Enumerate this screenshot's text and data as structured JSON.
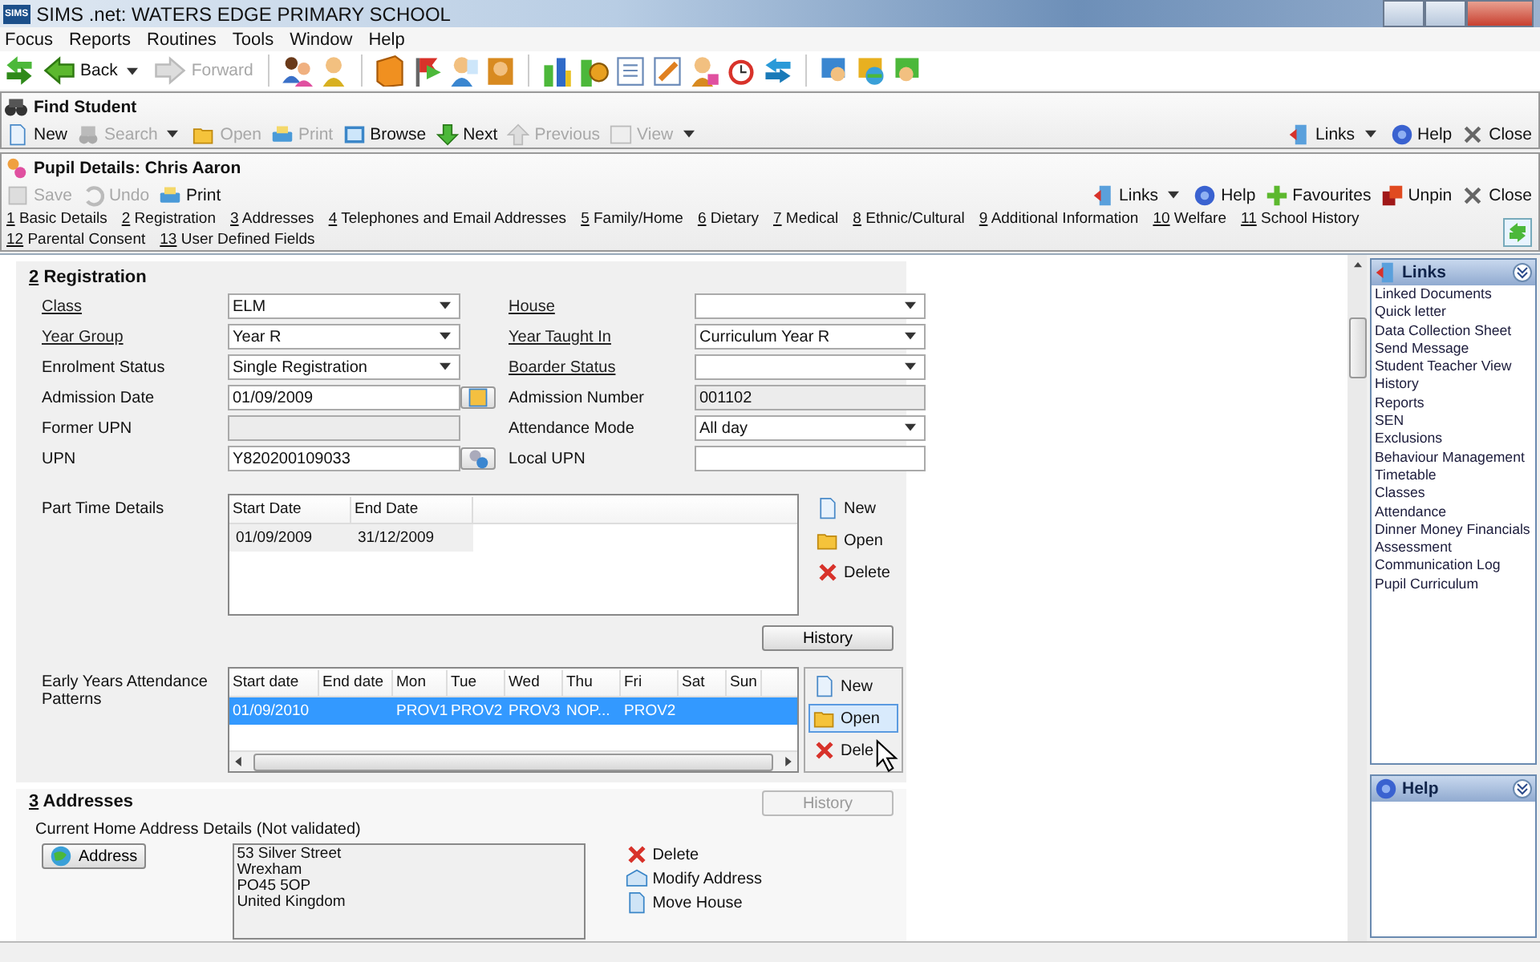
{
  "window": {
    "logo": "SIMS",
    "title": "SIMS .net: WATERS EDGE PRIMARY SCHOOL"
  },
  "menu": [
    {
      "label": "Focus"
    },
    {
      "label": "Reports"
    },
    {
      "label": "Routines"
    },
    {
      "label": "Tools"
    },
    {
      "label": "Window"
    },
    {
      "label": "Help"
    }
  ],
  "main_toolbar": [
    {
      "label": "Back",
      "kind": "back",
      "disabled": false,
      "dropdown": true
    },
    {
      "label": "Forward",
      "kind": "forward",
      "disabled": true,
      "dropdown": false
    }
  ],
  "find_student": {
    "title": "Find Student",
    "tools": [
      {
        "label": "New",
        "kind": "new",
        "disabled": false,
        "dropdown": false
      },
      {
        "label": "Search",
        "kind": "search",
        "disabled": true,
        "dropdown": true
      },
      {
        "label": "Open",
        "kind": "open",
        "disabled": true,
        "dropdown": false
      },
      {
        "label": "Print",
        "kind": "print",
        "disabled": true,
        "dropdown": false
      },
      {
        "label": "Browse",
        "kind": "browse",
        "disabled": false,
        "dropdown": false
      },
      {
        "label": "Next",
        "kind": "next",
        "disabled": false,
        "dropdown": false
      },
      {
        "label": "Previous",
        "kind": "previous",
        "disabled": true,
        "dropdown": false
      },
      {
        "label": "View",
        "kind": "view",
        "disabled": true,
        "dropdown": true
      }
    ],
    "right_tools": [
      {
        "label": "Links",
        "kind": "links",
        "dropdown": true
      },
      {
        "label": "Help",
        "kind": "help",
        "dropdown": false
      },
      {
        "label": "Close",
        "kind": "close",
        "dropdown": false
      }
    ]
  },
  "pupil": {
    "title": "Pupil Details: Chris Aaron",
    "tools": [
      {
        "label": "Save",
        "kind": "save",
        "disabled": true
      },
      {
        "label": "Undo",
        "kind": "undo",
        "disabled": true
      },
      {
        "label": "Print",
        "kind": "print",
        "disabled": false
      }
    ],
    "right_tools": [
      {
        "label": "Links",
        "kind": "links",
        "dropdown": true
      },
      {
        "label": "Help",
        "kind": "help",
        "dropdown": false
      },
      {
        "label": "Favourites",
        "kind": "favourites",
        "dropdown": false
      },
      {
        "label": "Unpin",
        "kind": "unpin",
        "dropdown": false
      },
      {
        "label": "Close",
        "kind": "close",
        "dropdown": false
      }
    ],
    "tabs": [
      {
        "number": "1",
        "label": "Basic Details"
      },
      {
        "number": "2",
        "label": "Registration"
      },
      {
        "number": "3",
        "label": "Addresses"
      },
      {
        "number": "4",
        "label": "Telephones and Email Addresses"
      },
      {
        "number": "5",
        "label": "Family/Home"
      },
      {
        "number": "6",
        "label": "Dietary"
      },
      {
        "number": "7",
        "label": "Medical"
      },
      {
        "number": "8",
        "label": "Ethnic/Cultural"
      },
      {
        "number": "9",
        "label": "Additional Information"
      },
      {
        "number": "10",
        "label": "Welfare"
      },
      {
        "number": "11",
        "label": "School History"
      },
      {
        "number": "12",
        "label": "Parental Consent"
      },
      {
        "number": "13",
        "label": "User Defined Fields"
      }
    ]
  },
  "registration": {
    "number": "2",
    "heading": "Registration",
    "left_fields": [
      {
        "label": "Class",
        "underlined": true,
        "kind": "dropdown",
        "value": "ELM"
      },
      {
        "label": "Year Group",
        "underlined": true,
        "kind": "dropdown",
        "value": "Year  R"
      },
      {
        "label": "Enrolment Status",
        "underlined": false,
        "kind": "dropdown",
        "value": "Single Registration"
      },
      {
        "label": "Admission Date",
        "underlined": false,
        "kind": "date",
        "value": "01/09/2009"
      },
      {
        "label": "Former UPN",
        "underlined": false,
        "kind": "readonly"
      },
      {
        "label": "UPN",
        "underlined": false,
        "kind": "lookup",
        "value": "Y820200109033"
      }
    ],
    "right_fields": [
      {
        "label": "House",
        "underlined": true,
        "kind": "dropdown"
      },
      {
        "label": "Year Taught In",
        "underlined": true,
        "kind": "dropdown",
        "value": "Curriculum Year  R"
      },
      {
        "label": "Boarder Status",
        "underlined": true,
        "kind": "dropdown"
      },
      {
        "label": "Admission Number",
        "underlined": false,
        "kind": "readonly",
        "value": "001102"
      },
      {
        "label": "Attendance Mode",
        "underlined": false,
        "kind": "dropdown",
        "value": "All day"
      },
      {
        "label": "Local UPN",
        "underlined": false,
        "kind": "text"
      }
    ],
    "part_time": {
      "label": "Part Time Details",
      "columns": [
        "Start Date",
        "End Date"
      ],
      "rows": [
        {
          "cells": [
            "01/09/2009",
            "31/12/2009"
          ],
          "selected": false
        }
      ],
      "actions": [
        {
          "label": "New",
          "kind": "new",
          "hovered": false
        },
        {
          "label": "Open",
          "kind": "open",
          "hovered": false
        },
        {
          "label": "Delete",
          "kind": "delete",
          "hovered": false
        }
      ],
      "history": {
        "label": "History",
        "disabled": false
      }
    },
    "early_years": {
      "label": "Early Years Attendance Patterns",
      "columns": [
        "Start date",
        "End date",
        "Mon",
        "Tue",
        "Wed",
        "Thu",
        "Fri",
        "Sat",
        "Sun"
      ],
      "rows": [
        {
          "cells": [
            "01/09/2010",
            "",
            "PROV1",
            "PROV2",
            "PROV3",
            "NOP...",
            "PROV2",
            "",
            ""
          ],
          "selected": true
        }
      ],
      "actions": [
        {
          "label": "New",
          "kind": "new",
          "hovered": false
        },
        {
          "label": "Open",
          "kind": "open",
          "hovered": true
        },
        {
          "label": "Dele",
          "kind": "delete",
          "hovered": false
        }
      ]
    }
  },
  "addresses": {
    "number": "3",
    "heading": "Addresses",
    "history": {
      "label": "History",
      "disabled": true
    },
    "current_label": "Current Home Address Details (Not validated)",
    "address_button": "Address",
    "lines": [
      "53 Silver Street",
      "Wrexham",
      "PO45 5OP",
      "United Kingdom"
    ],
    "actions": [
      {
        "label": "Delete",
        "kind": "delete"
      },
      {
        "label": "Modify Address",
        "kind": "modify"
      },
      {
        "label": "Move House",
        "kind": "move"
      }
    ]
  },
  "links_panel": {
    "title": "Links",
    "items": [
      "Linked Documents",
      "Quick letter",
      "Data Collection Sheet",
      "Send Message",
      "Student Teacher View",
      "History",
      "Reports",
      "SEN",
      "Exclusions",
      "Behaviour Management",
      "Timetable",
      "Classes",
      "Attendance",
      "Dinner Money Financials",
      "Assessment",
      "Communication Log",
      "Pupil Curriculum"
    ]
  },
  "help_panel": {
    "title": "Help"
  }
}
